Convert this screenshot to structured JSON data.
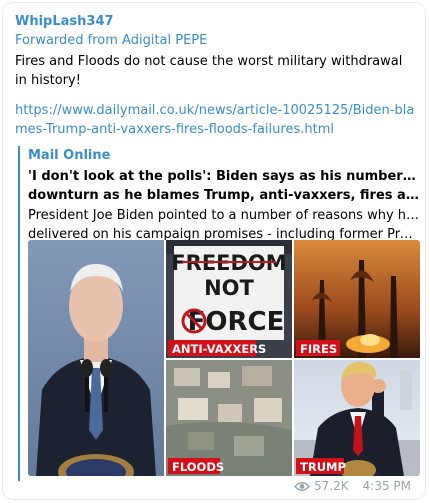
{
  "message": {
    "sender": "WhipLash347",
    "forwarded_from": "Forwarded from Adigital PEPE",
    "text": "Fires and Floods do not cause the worst military withdrawal in history!",
    "link": "https://www.dailymail.co.uk/news/article-10025125/Biden-blames-Trump-anti-vaxxers-fires-floods-failures.html"
  },
  "preview": {
    "site_name": "Mail Online",
    "title_line1": "'I don't look at the polls': Biden says as his numbers take a",
    "title_line2": "downturn as he blames Trump, anti-vaxxers, fires and floods f...",
    "desc_line1": "President Joe Biden pointed to a number of reasons why he hasn't",
    "desc_line2": "delivered on his campaign promises - including former President ...",
    "image": {
      "sign_line1": "FREEDOM",
      "sign_line2": "NOT",
      "sign_line3": "FORCE",
      "captions": {
        "anti_vaxxers": "ANTI-VAXXERS",
        "fires": "FIRES",
        "floods": "FLOODS",
        "trump": "TRUMP"
      }
    }
  },
  "footer": {
    "views": "57.2K",
    "time": "4:35 PM",
    "eye_icon": "eye-icon"
  },
  "colors": {
    "accent": "#3b8ec9",
    "caption_red": "#d3101a",
    "meta_gray": "#9aa4ad"
  }
}
